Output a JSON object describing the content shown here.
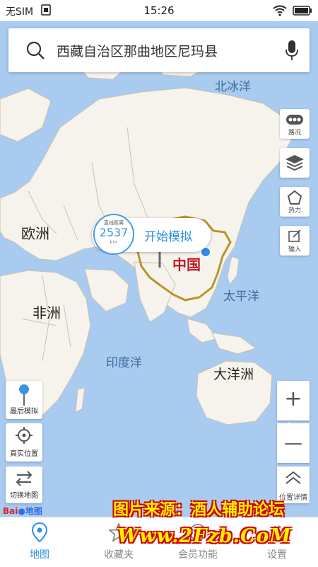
{
  "status_bar": {
    "carrier": "无SIM",
    "time": "15:26"
  },
  "search": {
    "query": "西藏自治区那曲地区尼玛县"
  },
  "map_labels": {
    "arctic_ocean": "北冰洋",
    "europe": "欧洲",
    "africa": "非洲",
    "china": "中国",
    "pacific_ocean": "太平洋",
    "indian_ocean": "印度洋",
    "oceania": "大洋洲"
  },
  "right_tools": [
    {
      "label": "路况",
      "icon": "traffic-icon"
    },
    {
      "label": "",
      "icon": "layers-icon"
    },
    {
      "label": "热力",
      "icon": "heat-icon"
    },
    {
      "label": "输入",
      "icon": "edit-icon"
    }
  ],
  "distance_bubble": {
    "caption": "直线距离",
    "value": "2537",
    "unit": "km",
    "action": "开始模拟"
  },
  "left_tools": {
    "last_sim": "最后模拟",
    "real_location": "真实位置",
    "switch_map": "切换地图"
  },
  "zoom": {
    "in": "+",
    "out": "—"
  },
  "location_detail": "位置详情",
  "brand": {
    "bai": "Bai",
    "du_map": "地图"
  },
  "tabs": [
    {
      "label": "地图",
      "active": true
    },
    {
      "label": "收藏夹",
      "active": false
    },
    {
      "label": "会员功能",
      "active": false
    },
    {
      "label": "设置",
      "active": false
    }
  ],
  "watermark": {
    "line1": "图片来源：酒人辅助论坛",
    "line2": "Www.2Fzb.CoM"
  },
  "colors": {
    "accent": "#2e8de6",
    "ocean": "#a9cbf0",
    "land": "#f6f3ec",
    "china_border": "#b8952c"
  }
}
